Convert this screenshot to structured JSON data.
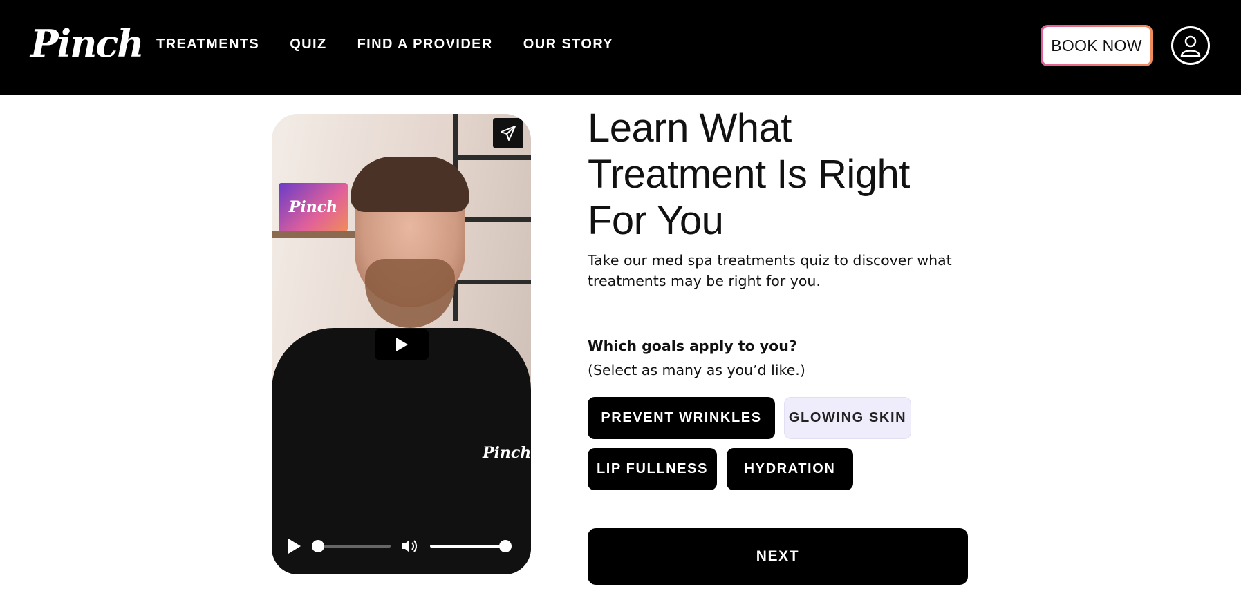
{
  "header": {
    "logo": "Pinch",
    "nav": [
      "TREATMENTS",
      "QUIZ",
      "FIND A PROVIDER",
      "OUR STORY"
    ],
    "book_label": "BOOK NOW"
  },
  "video": {
    "sign_text": "Pinch",
    "shirt_text": "Pinch",
    "progress": 0.0,
    "volume": 1.0
  },
  "quiz": {
    "title_lines": [
      "Learn What",
      "Treatment Is Right",
      "For You"
    ],
    "subtitle": "Take our med spa treatments quiz to discover what treatments may be right for you.",
    "question": "Which goals apply to you?",
    "hint": "(Select as many as you’d like.)",
    "options": [
      {
        "label": "PREVENT WRINKLES",
        "selected": true
      },
      {
        "label": "GLOWING SKIN",
        "selected": false
      },
      {
        "label": "LIP FULLNESS",
        "selected": true
      },
      {
        "label": "HYDRATION",
        "selected": true
      }
    ],
    "next_label": "NEXT"
  },
  "colors": {
    "header_bg": "#000000",
    "book_gradient": [
      "#e0609a",
      "#f08c5a"
    ],
    "chip_selected_bg": "#000000",
    "chip_unselected_bg": "#efecfb"
  }
}
